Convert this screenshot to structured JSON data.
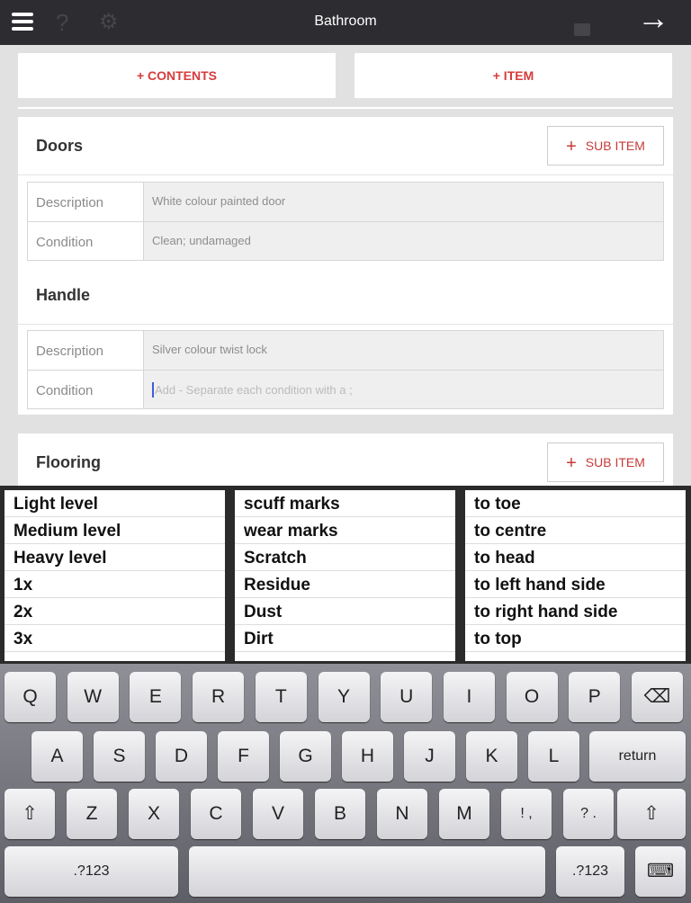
{
  "header": {
    "title": "Bathroom",
    "icons": [
      "menu-icon",
      "help-icon",
      "gear-icon",
      "unlock-icon",
      "arrow-right-icon"
    ]
  },
  "toolbar": {
    "contents": "+ CONTENTS",
    "item": "+ ITEM"
  },
  "sections": [
    {
      "title": "Doors",
      "sub_item": "SUB ITEM",
      "rows": [
        {
          "label": "Description",
          "value": "White colour painted door"
        },
        {
          "label": "Condition",
          "value": "Clean; undamaged"
        }
      ]
    },
    {
      "title": "Handle",
      "rows": [
        {
          "label": "Description",
          "value": "Silver colour twist lock"
        },
        {
          "label": "Condition",
          "placeholder": "Add - Separate each condition with a ;"
        }
      ]
    },
    {
      "title": "Flooring",
      "sub_item": "SUB ITEM"
    }
  ],
  "picker": {
    "columns": [
      [
        "Light level",
        "Medium level",
        "Heavy level",
        "1x",
        "2x",
        "3x"
      ],
      [
        "scuff marks",
        "wear marks",
        "Scratch",
        "Residue",
        "Dust",
        "Dirt"
      ],
      [
        "to toe",
        "to centre",
        "to head",
        "to left hand side",
        "to right hand side",
        "to top"
      ]
    ]
  },
  "keyboard": {
    "rows": [
      [
        "Q",
        "W",
        "E",
        "R",
        "T",
        "Y",
        "U",
        "I",
        "O",
        "P",
        "⌫"
      ],
      [
        "A",
        "S",
        "D",
        "F",
        "G",
        "H",
        "J",
        "K",
        "L",
        "return"
      ],
      [
        "⇧",
        "Z",
        "X",
        "C",
        "V",
        "B",
        "N",
        "M",
        "! ,",
        "? .",
        "⇧"
      ],
      [
        ".?123",
        "",
        ".?123",
        "⌨"
      ]
    ]
  }
}
